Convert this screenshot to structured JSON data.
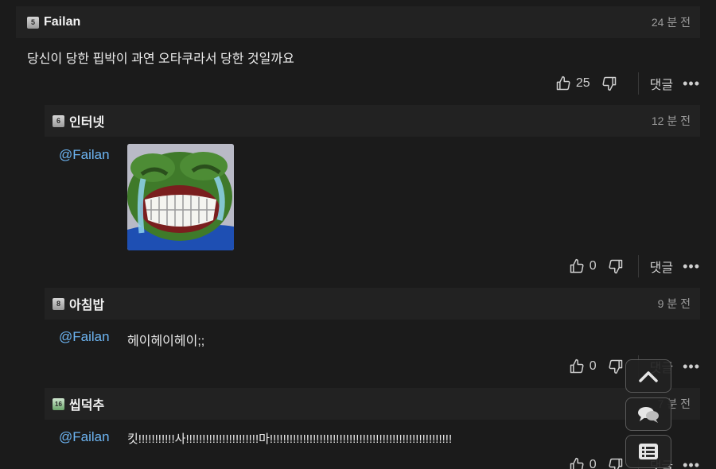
{
  "comments": [
    {
      "nick": "Failan",
      "level": "5",
      "time": "24 분 전",
      "text": "당신이 당한 핍박이 과연 오타쿠라서 당한 것일까요",
      "likes": "25",
      "reply": "댓글"
    },
    {
      "nick": "인터넷",
      "level": "6",
      "time": "12 분 전",
      "mention": "@Failan",
      "likes": "0",
      "reply": "댓글"
    },
    {
      "nick": "아침밥",
      "level": "8",
      "time": "9 분 전",
      "mention": "@Failan",
      "text": "헤이헤이헤이;;",
      "likes": "0",
      "reply": "댓글"
    },
    {
      "nick": "씹덕추",
      "level": "16",
      "time": "7 분 전",
      "mention": "@Failan",
      "text": "킷!!!!!!!!!!!사!!!!!!!!!!!!!!!!!!!!!!마!!!!!!!!!!!!!!!!!!!!!!!!!!!!!!!!!!!!!!!!!!!!!!!!!!!!!!!",
      "likes": "0",
      "reply": "댓글"
    }
  ],
  "more_label": "•••",
  "icons": {
    "level_badge": "level-badge-icon",
    "like": "thumbs-up-icon",
    "dislike": "thumbs-down-icon",
    "scroll_top": "chevron-up-icon",
    "comments": "chat-bubbles-icon",
    "list": "list-icon"
  },
  "colors": {
    "mention": "#6cb4f2",
    "background": "#1b1b1b",
    "header": "#222222"
  }
}
